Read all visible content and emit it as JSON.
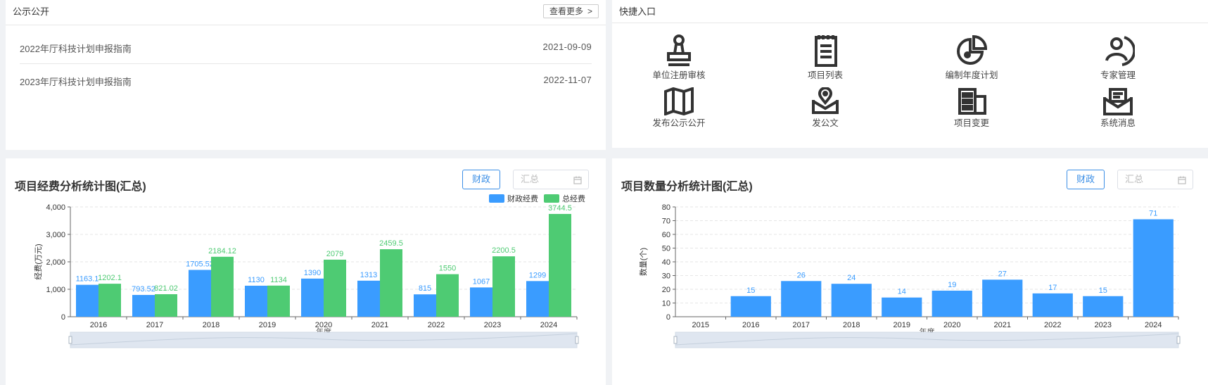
{
  "notice": {
    "title": "公示公开",
    "more_label": "查看更多",
    "items": [
      {
        "title": "2022年厅科技计划申报指南",
        "date": "2021-09-09"
      },
      {
        "title": "2023年厅科技计划申报指南",
        "date": "2022-11-07"
      }
    ]
  },
  "quick": {
    "title": "快捷入口",
    "items": [
      {
        "label": "单位注册审核",
        "icon": "stamp-icon"
      },
      {
        "label": "项目列表",
        "icon": "list-icon"
      },
      {
        "label": "编制年度计划",
        "icon": "pie-chart-icon"
      },
      {
        "label": "专家管理",
        "icon": "expert-icon"
      },
      {
        "label": "发布公示公开",
        "icon": "map-icon"
      },
      {
        "label": "发公文",
        "icon": "mail-pin-icon"
      },
      {
        "label": "项目变更",
        "icon": "building-icon"
      },
      {
        "label": "系统消息",
        "icon": "message-icon"
      }
    ]
  },
  "chart1": {
    "title": "项目经费分析统计图(汇总)",
    "filter_button": "财政",
    "select_placeholder": "汇总"
  },
  "chart2": {
    "title": "项目数量分析统计图(汇总)",
    "filter_button": "财政",
    "select_placeholder": "汇总"
  },
  "colors": {
    "blue": "#3a9cff",
    "green": "#4ecb73",
    "accent": "#3a8ee6"
  },
  "chart_data": [
    {
      "type": "bar",
      "categories": [
        "2016",
        "2017",
        "2018",
        "2019",
        "2020",
        "2021",
        "2022",
        "2023",
        "2024"
      ],
      "series": [
        {
          "name": "财政经费",
          "values": [
            1163.1,
            793.52,
            1705.52,
            1130,
            1390,
            1313,
            815,
            1067,
            1299
          ],
          "labels": [
            "1163.1",
            "793.52",
            "1705.52",
            "1130",
            "1390",
            "1313",
            "815",
            "1067",
            "1299"
          ]
        },
        {
          "name": "总经费",
          "values": [
            1202.1,
            821.02,
            2184.12,
            1134,
            2079,
            2459.5,
            1550,
            2200.5,
            3744.5
          ],
          "labels": [
            "1202.1",
            "821.02",
            "2184.12",
            "1134",
            "2079",
            "2459.5",
            "1550",
            "2200.5",
            "3744.5"
          ]
        }
      ],
      "xlabel": "年度",
      "ylabel": "经费(万元)",
      "ylim": [
        0,
        4000
      ],
      "yticks": [
        "0",
        "1,000",
        "2,000",
        "3,000",
        "4,000"
      ],
      "ytick_values": [
        0,
        1000,
        2000,
        3000,
        4000
      ],
      "legend": "top-right",
      "grid": true
    },
    {
      "type": "bar",
      "categories": [
        "2015",
        "2016",
        "2017",
        "2018",
        "2019",
        "2020",
        "2021",
        "2022",
        "2023",
        "2024"
      ],
      "series": [
        {
          "values": [
            null,
            15,
            26,
            24,
            14,
            19,
            27,
            17,
            15,
            71
          ],
          "labels": [
            "",
            "15",
            "26",
            "24",
            "14",
            "19",
            "27",
            "17",
            "15",
            "71"
          ]
        }
      ],
      "xlabel": "年度",
      "ylabel": "数量(个)",
      "ylim": [
        0,
        80
      ],
      "yticks": [
        "0",
        "10",
        "20",
        "30",
        "40",
        "50",
        "60",
        "70",
        "80"
      ],
      "ytick_values": [
        0,
        10,
        20,
        30,
        40,
        50,
        60,
        70,
        80
      ],
      "grid": true
    }
  ]
}
